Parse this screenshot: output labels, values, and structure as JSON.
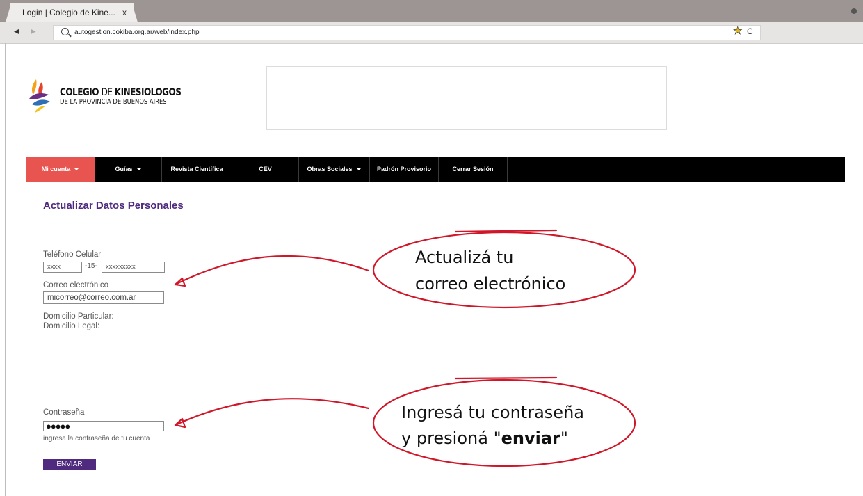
{
  "browser": {
    "tab_title": "Login | Colegio de Kine...",
    "tab_close": "x",
    "url": "autogestion.cokiba.org.ar/web/index.php",
    "back_glyph": "◀",
    "forward_glyph": "▶",
    "star_glyph": "★",
    "reload_glyph": "C",
    "icons": [
      "search-icon",
      "star-icon",
      "reload-icon"
    ]
  },
  "header": {
    "logo_line1_a": "COLEGIO ",
    "logo_line1_b": "DE ",
    "logo_line1_c": "KINESIOLOGOS",
    "logo_line2": "DE LA PROVINCIA DE BUENOS AIRES"
  },
  "menu": {
    "items": [
      {
        "label": "Mi cuenta",
        "dropdown": true,
        "active": true
      },
      {
        "label": "Guías",
        "dropdown": true
      },
      {
        "label": "Revista Científica"
      },
      {
        "label": "CEV"
      },
      {
        "label": "Obras Sociales",
        "dropdown": true
      },
      {
        "label": "Padrón Provisorio"
      },
      {
        "label": "Cerrar Sesión"
      }
    ],
    "active_color": "#e85551"
  },
  "form": {
    "title": "Actualizar Datos Personales",
    "phone_label": "Teléfono Celular",
    "phone_area": "xxxx",
    "phone_sep": "-15-",
    "phone_number": "xxxxxxxxx",
    "email_label": "Correo electrónico",
    "email_value": "micorreo@correo.com.ar",
    "domicilio_particular": "Domicilio Particular:",
    "domicilio_legal": "Domicilio Legal:",
    "password_label": "Contraseña",
    "password_value": "●●●●●",
    "password_hint": "ingresa la contraseña de tu cuenta",
    "submit_label": "ENVIAR",
    "accent_color": "#4f2a7e"
  },
  "callouts": {
    "email_line1": "Actualizá tu",
    "email_line2": "correo electrónico",
    "password_line1": "Ingresá tu contraseña",
    "password_line2_a": "y presioná \"",
    "password_line2_b": "enviar",
    "password_line2_c": "\"",
    "color": "#d0172a"
  }
}
